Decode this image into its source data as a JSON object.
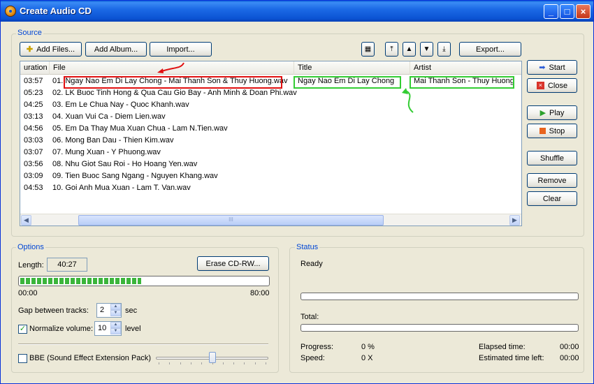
{
  "window": {
    "title": "Create Audio CD"
  },
  "source": {
    "label": "Source",
    "buttons": {
      "add_files": "Add Files...",
      "add_album": "Add Album...",
      "import": "Import...",
      "export": "Export..."
    },
    "columns": {
      "duration": "uration",
      "file": "File",
      "title": "Title",
      "artist": "Artist"
    },
    "rows": [
      {
        "duration": "03:57",
        "file": "01. Ngay Nao Em Di Lay Chong - Mai Thanh Son & Thuy Huong.wav",
        "title": "Ngay Nao Em Di Lay Chong",
        "artist": "Mai Thanh Son - Thuy Huong"
      },
      {
        "duration": "05:23",
        "file": "02. LK Buoc Tinh Hong & Qua Cau Gio Bay - Anh Minh & Doan Phi.wav",
        "title": "",
        "artist": ""
      },
      {
        "duration": "04:25",
        "file": "03. Em Le Chua Nay - Quoc Khanh.wav",
        "title": "",
        "artist": ""
      },
      {
        "duration": "03:13",
        "file": "04. Xuan Vui Ca - Diem Lien.wav",
        "title": "",
        "artist": ""
      },
      {
        "duration": "04:56",
        "file": "05. Em Da Thay Mua Xuan Chua - Lam N.Tien.wav",
        "title": "",
        "artist": ""
      },
      {
        "duration": "03:03",
        "file": "06. Mong Ban Dau - Thien Kim.wav",
        "title": "",
        "artist": ""
      },
      {
        "duration": "03:07",
        "file": "07. Mung Xuan - Y Phuong.wav",
        "title": "",
        "artist": ""
      },
      {
        "duration": "03:56",
        "file": "08. Nhu Giot Sau Roi - Ho Hoang Yen.wav",
        "title": "",
        "artist": ""
      },
      {
        "duration": "03:09",
        "file": "09. Tien Buoc Sang Ngang - Nguyen Khang.wav",
        "title": "",
        "artist": ""
      },
      {
        "duration": "04:53",
        "file": "10. Goi Anh Mua Xuan - Lam T. Van.wav",
        "title": "",
        "artist": ""
      }
    ],
    "scroll_thumb_label": "III"
  },
  "side_buttons": {
    "start": "Start",
    "close": "Close",
    "play": "Play",
    "stop": "Stop",
    "shuffle": "Shuffle",
    "remove": "Remove",
    "clear": "Clear"
  },
  "options": {
    "label": "Options",
    "length_label": "Length:",
    "length_value": "40:27",
    "erase_button": "Erase CD-RW...",
    "progress_fraction": 0.49,
    "time_start": "00:00",
    "time_end": "80:00",
    "gap_label": "Gap between tracks:",
    "gap_value": "2",
    "gap_unit": "sec",
    "normalize_checked": true,
    "normalize_label": "Normalize volume:",
    "normalize_value": "10",
    "normalize_unit": "level",
    "bbe_checked": false,
    "bbe_label": "BBE (Sound Effect Extension Pack)",
    "bbe_slider_fraction": 0.5
  },
  "status": {
    "label": "Status",
    "state": "Ready",
    "total_label": "Total:",
    "progress_label": "Progress:",
    "progress_value": "0 %",
    "speed_label": "Speed:",
    "speed_value": "0 X",
    "elapsed_label": "Elapsed time:",
    "elapsed_value": "00:00",
    "estimated_label": "Estimated time left:",
    "estimated_value": "00:00"
  },
  "colors": {
    "titlebar": "#0b53d3",
    "group_label": "#0046d5",
    "annotation_red": "#e01010",
    "annotation_green": "#33cc33"
  }
}
